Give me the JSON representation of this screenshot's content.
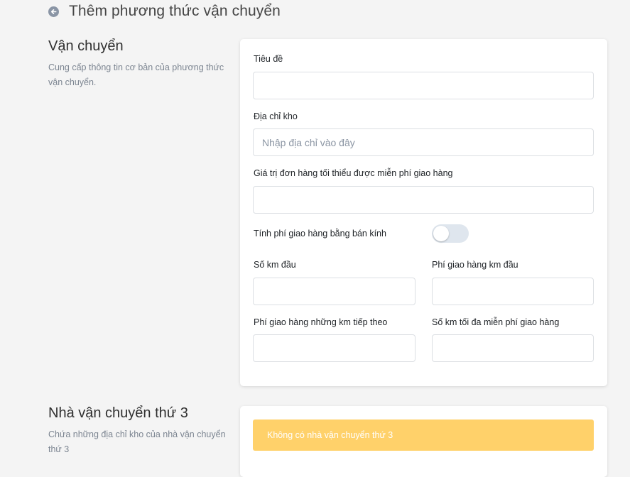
{
  "header": {
    "title": "Thêm phương thức vận chuyển",
    "back_icon": "arrow-left-circle-icon"
  },
  "shipping_section": {
    "title": "Vận chuyển",
    "description": "Cung cấp thông tin cơ bản của phương thức vận chuyển."
  },
  "form": {
    "title_label": "Tiêu đề",
    "title_value": "",
    "warehouse_label": "Địa chỉ kho",
    "warehouse_placeholder": "Nhập địa chỉ vào đây",
    "min_order_label": "Giá trị đơn hàng tối thiểu được miễn phí giao hàng",
    "min_order_value": "",
    "radius_toggle_label": "Tính phí giao hàng bằng bán kính",
    "radius_toggle_on": false,
    "first_km_label": "Số km đầu",
    "first_km_fee_label": "Phí giao hàng km đầu",
    "next_km_fee_label": "Phí giao hàng những km tiếp theo",
    "max_free_km_label": "Số km tối đa miễn phí giao hàng"
  },
  "third_party_section": {
    "title": "Nhà vận chuyển thứ 3",
    "description": "Chứa những địa chỉ kho của nhà vận chuyển thứ 3",
    "empty_alert": "Không có nhà vận chuyển thứ 3",
    "alert_color": "#ffd16a"
  }
}
